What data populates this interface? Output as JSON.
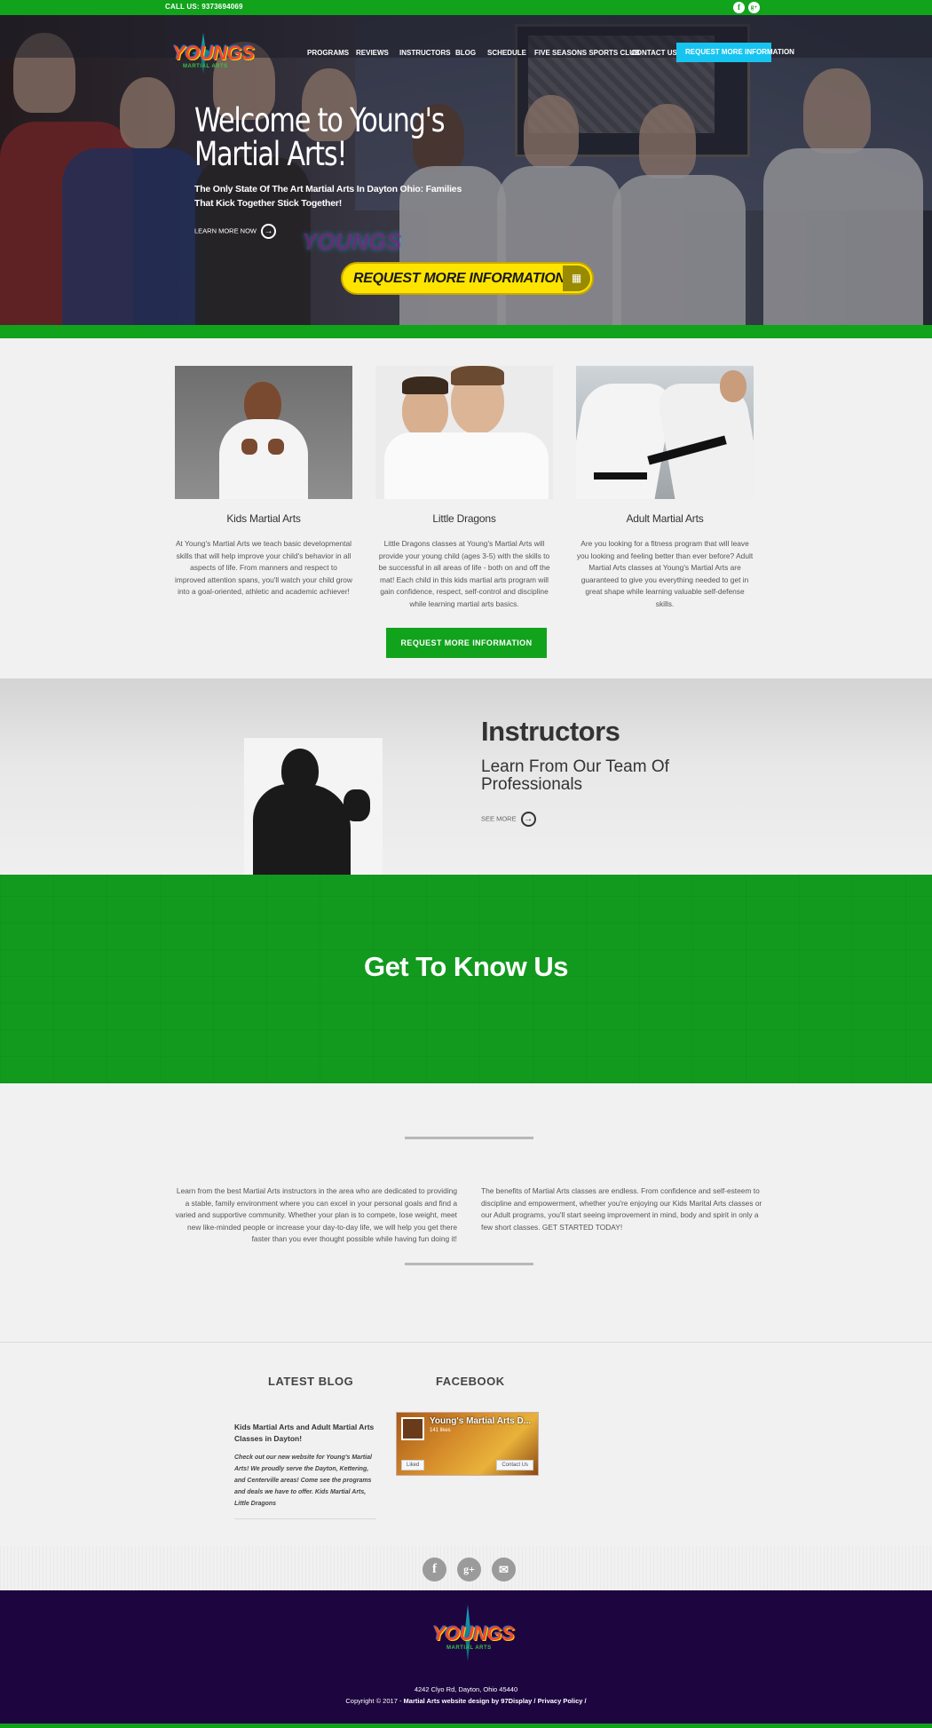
{
  "topbar": {
    "call_us": "CALL US: 9373694069",
    "social": [
      "f",
      "g+"
    ]
  },
  "brand": {
    "logo_text": "YOUNGS",
    "logo_sub": "MARTIAL ARTS"
  },
  "nav": {
    "items": [
      "PROGRAMS",
      "REVIEWS",
      "INSTRUCTORS",
      "BLOG",
      "SCHEDULE",
      "FIVE SEASONS SPORTS CLUB",
      "CONTACT US"
    ],
    "cta": "REQUEST MORE INFORMATION"
  },
  "hero": {
    "title_line1": "Welcome to Young's",
    "title_line2": "Martial Arts!",
    "subtitle": "The Only State Of The Art Martial Arts In Dayton Ohio: Families That Kick Together Stick Together!",
    "learn_more": "LEARN MORE NOW",
    "cta": "REQUEST MORE INFORMATION",
    "watermark": "YOUNGS"
  },
  "programs": [
    {
      "title": "Kids Martial Arts",
      "text": "At Young's Martial Arts we teach basic developmental skills that will help improve your child's behavior in all aspects of life. From manners and respect to improved attention spans, you'll watch your child grow into a goal-oriented, athletic and academic achiever!"
    },
    {
      "title": "Little Dragons",
      "text": "Little Dragons classes at Young's Martial Arts will provide your young child (ages 3-5) with the skills to be successful in all areas of life - both on and off the mat! Each child in this kids martial arts program will gain confidence, respect, self-control and discipline while learning martial arts basics."
    },
    {
      "title": "Adult Martial Arts",
      "text": "Are you looking for a fitness program that will leave you looking and feeling better than ever before? Adult Martial Arts classes at Young's Martial Arts are guaranteed to give you everything needed to get in great shape while learning valuable self-defense skills."
    }
  ],
  "programs_cta": "REQUEST MORE INFORMATION",
  "instructors": {
    "heading": "Instructors",
    "tagline": "Learn From Our Team Of Professionals",
    "see_more": "SEE MORE"
  },
  "know": {
    "heading": "Get To Know Us",
    "left": "Learn from the best Martial Arts instructors in the area who are dedicated to providing a stable, family environment where you can excel in your personal goals and find a varied and supportive community. Whether your plan is to compete, lose weight, meet new like-minded people or increase your day-to-day life, we will help you get there faster than you ever thought possible while having fun doing it!",
    "right": "The benefits of Martial Arts classes are endless. From confidence and self-esteem to discipline and empowerment, whether you're enjoying our Kids Marital Arts classes or our Adult programs, you'll start seeing improvement in mind, body and spirit in only a few short classes. GET STARTED TODAY!"
  },
  "blog": {
    "heading": "LATEST BLOG",
    "post_title": "Kids Martial Arts and Adult Martial Arts Classes in Dayton!",
    "post_excerpt": "Check out our new website for Young's Martial Arts! We proudly serve the Dayton, Kettering, and Centerville areas! Come see the programs and deals we have to offer. Kids Martial Arts, Little Dragons"
  },
  "facebook": {
    "heading": "FACEBOOK",
    "page_name": "Young's Martial Arts D...",
    "likes": "141 likes",
    "liked_btn": "Liked",
    "contact_btn": "Contact Us"
  },
  "social_icons": [
    "f",
    "g+",
    "✉"
  ],
  "footer": {
    "address": "4242 Clyo Rd, Dayton, Ohio 45440",
    "copyright": "Copyright © 2017 - ",
    "credit": "Martial Arts website design by 97Display / Privacy Policy /"
  }
}
